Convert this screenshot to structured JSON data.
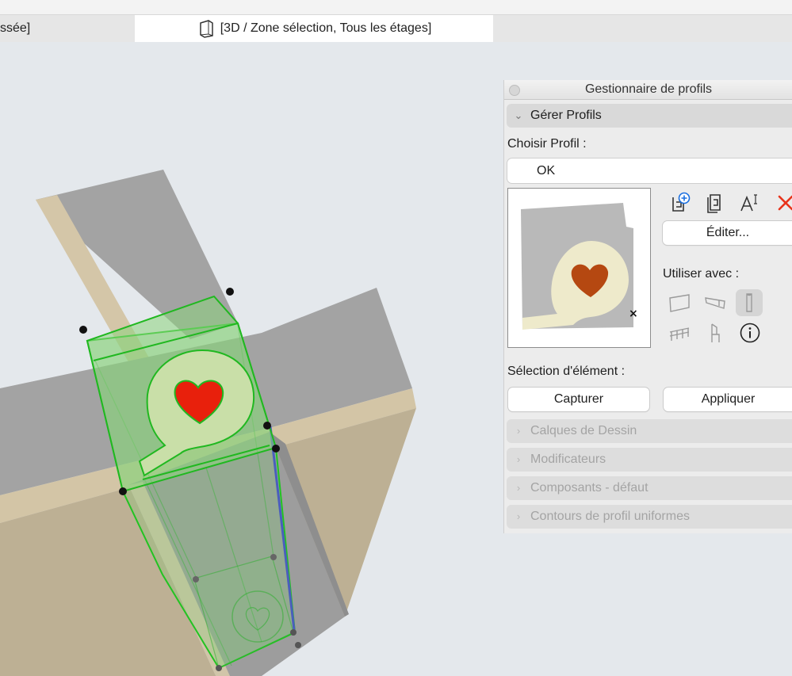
{
  "window": {
    "tab_left_label": "ssée]",
    "tab_active_label": "[3D / Zone sélection, Tous les étages]"
  },
  "panel": {
    "title": "Gestionnaire de profils",
    "section_manage": "Gérer Profils",
    "choose_label": "Choisir Profil :",
    "selected_profile": "OK",
    "edit_button": "Éditer...",
    "use_with_label": "Utiliser avec :",
    "element_selection_label": "Sélection d'élément :",
    "capture_button": "Capturer",
    "apply_button": "Appliquer",
    "collapsed_sections": [
      "Calques de Dessin",
      "Modificateurs",
      "Composants - défaut",
      "Contours de profil uniformes"
    ],
    "toolbar_icons": [
      "new-profile-icon",
      "duplicate-profile-icon",
      "rename-profile-icon",
      "delete-profile-icon"
    ],
    "use_with_icons": [
      "wall-icon",
      "beam-icon",
      "column-icon",
      "railing-icon",
      "object-icon",
      "info-icon"
    ]
  },
  "colors": {
    "accent_delete": "#e8341c",
    "selection_green": "#22c322",
    "heart_red": "#e8200c",
    "heart_preview": "#b54811",
    "profile_cream": "#eeeacb"
  }
}
